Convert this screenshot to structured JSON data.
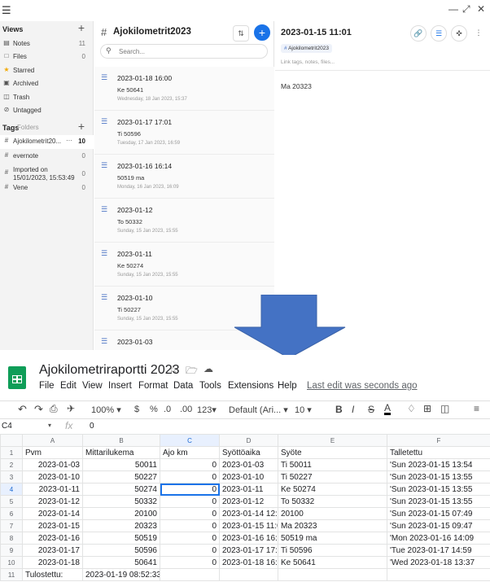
{
  "notes_app": {
    "sidebar": {
      "views_label": "Views",
      "views": [
        {
          "icon": "note-icon",
          "label": "Notes",
          "count": "11"
        },
        {
          "icon": "file-icon",
          "label": "Files",
          "count": "0"
        },
        {
          "icon": "star-icon",
          "label": "Starred",
          "count": ""
        },
        {
          "icon": "archive-icon",
          "label": "Archived",
          "count": ""
        },
        {
          "icon": "trash-icon",
          "label": "Trash",
          "count": ""
        },
        {
          "icon": "untagged-icon",
          "label": "Untagged",
          "count": ""
        }
      ],
      "tags_label": "Tags",
      "folders_label": "Folders",
      "tags": [
        {
          "label": "Ajokilometrit20...",
          "extra": "···",
          "count": "10"
        },
        {
          "label": "evernote",
          "count": "0"
        },
        {
          "label": "Imported on 15/01/2023, 15:53:49",
          "count": "0"
        },
        {
          "label": "Vene",
          "count": "0"
        }
      ]
    },
    "list": {
      "title": "Ajokilometrit2023",
      "search_placeholder": "Search...",
      "items": [
        {
          "title": "2023-01-18 16:00",
          "preview": "Ke 50641",
          "date": "Wednesday, 18 Jan 2023, 15:37"
        },
        {
          "title": "2023-01-17 17:01",
          "preview": "Ti 50596",
          "date": "Tuesday, 17 Jan 2023, 16:59"
        },
        {
          "title": "2023-01-16 16:14",
          "preview": "50519 ma",
          "date": "Monday, 16 Jan 2023, 16:09"
        },
        {
          "title": "2023-01-12",
          "preview": "To 50332",
          "date": "Sunday, 15 Jan 2023, 15:55"
        },
        {
          "title": "2023-01-11",
          "preview": "Ke 50274",
          "date": "Sunday, 15 Jan 2023, 15:55"
        },
        {
          "title": "2023-01-10",
          "preview": "Ti 50227",
          "date": "Sunday, 15 Jan 2023, 15:55"
        },
        {
          "title": "2023-01-03",
          "preview": "",
          "date": ""
        }
      ]
    },
    "detail": {
      "title": "2023-01-15 11:01",
      "tag": "Ajokilometrit2023",
      "links_placeholder": "Link tags, notes, files...",
      "body": "Ma 20323"
    }
  },
  "sheets": {
    "doc_title": "Ajokilometriraportti 2023",
    "menu": [
      "File",
      "Edit",
      "View",
      "Insert",
      "Format",
      "Data",
      "Tools",
      "Extensions",
      "Help"
    ],
    "last_edit": "Last edit was seconds ago",
    "toolbar": {
      "zoom": "100%",
      "currency": "$",
      "percent": "%",
      "dec_decrease": ".0",
      "dec_increase": ".00",
      "number_format": "123",
      "font": "Default (Ari...",
      "font_size": "10"
    },
    "cell_ref": "C4",
    "formula_value": "0",
    "column_headers": [
      "",
      "A",
      "B",
      "C",
      "D",
      "E",
      "F"
    ],
    "rows": [
      {
        "n": "1",
        "a": "Pvm",
        "b": "Mittarilukema",
        "c": "Ajo km",
        "d": "Syöttöaika",
        "e": "Syöte",
        "f": "Talletettu"
      },
      {
        "n": "2",
        "a": "2023-01-03",
        "b": "50011",
        "c": "0",
        "d": "2023-01-03",
        "e": "Ti 50011",
        "f": "'Sun 2023-01-15 13:54"
      },
      {
        "n": "3",
        "a": "2023-01-10",
        "b": "50227",
        "c": "0",
        "d": "2023-01-10",
        "e": "Ti 50227",
        "f": "'Sun 2023-01-15 13:55"
      },
      {
        "n": "4",
        "a": "2023-01-11",
        "b": "50274",
        "c": "0",
        "d": "2023-01-11",
        "e": "Ke 50274",
        "f": "'Sun 2023-01-15 13:55"
      },
      {
        "n": "5",
        "a": "2023-01-12",
        "b": "50332",
        "c": "0",
        "d": "2023-01-12",
        "e": "To 50332",
        "f": "'Sun 2023-01-15 13:55"
      },
      {
        "n": "6",
        "a": "2023-01-14",
        "b": "20100",
        "c": "0",
        "d": "2023-01-14 12:0",
        "e": "20100",
        "f": "'Sun 2023-01-15 07:49"
      },
      {
        "n": "7",
        "a": "2023-01-15",
        "b": "20323",
        "c": "0",
        "d": "2023-01-15 11:0",
        "e": "Ma 20323",
        "f": "'Sun 2023-01-15 09:47"
      },
      {
        "n": "8",
        "a": "2023-01-16",
        "b": "50519",
        "c": "0",
        "d": "2023-01-16 16:1",
        "e": "50519 ma",
        "f": "'Mon 2023-01-16 14:09"
      },
      {
        "n": "9",
        "a": "2023-01-17",
        "b": "50596",
        "c": "0",
        "d": "2023-01-17 17:0",
        "e": "Ti 50596",
        "f": "'Tue 2023-01-17 14:59"
      },
      {
        "n": "10",
        "a": "2023-01-18",
        "b": "50641",
        "c": "0",
        "d": "2023-01-18 16:0",
        "e": "Ke 50641",
        "f": "'Wed 2023-01-18 13:37"
      },
      {
        "n": "11",
        "a": "Tulostettu:",
        "b": "2023-01-19 08:52:33",
        "c": "",
        "d": "",
        "e": "",
        "f": ""
      }
    ]
  },
  "colors": {
    "accent_blue": "#4472c4",
    "sheets_green": "#0f9d58",
    "fab_blue": "#1a73e8"
  }
}
